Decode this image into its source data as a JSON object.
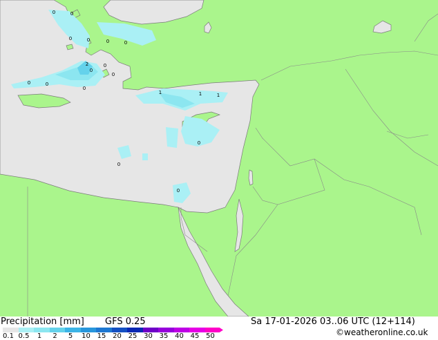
{
  "legend": {
    "title": "Precipitation [mm]",
    "model": "GFS 0.25",
    "datetime": "Sa 17-01-2026 03..06 UTC (12+114)",
    "credit": "©weatheronline.co.uk",
    "scale_labels": [
      "0.1",
      "0.5",
      "1",
      "2",
      "5",
      "10",
      "15",
      "20",
      "25",
      "30",
      "35",
      "40",
      "45",
      "50"
    ],
    "scale_colors": [
      "#e6e6e6",
      "#aaf0f5",
      "#8ce6f0",
      "#64d2eb",
      "#3cb4e6",
      "#2896dc",
      "#1e78d2",
      "#1450c3",
      "#0a28b4",
      "#6e00c8",
      "#9600dc",
      "#be00e6",
      "#e600e6",
      "#ff00c8"
    ]
  },
  "colors": {
    "land": "#aaf58c",
    "sea": "#e6e6e6"
  },
  "map_labels": [
    "0",
    "0",
    "0",
    "0",
    "0",
    "0",
    "0",
    "0",
    "0",
    "2",
    "0",
    "0",
    "0",
    "1",
    "1",
    "1",
    "0",
    "0",
    "0"
  ]
}
